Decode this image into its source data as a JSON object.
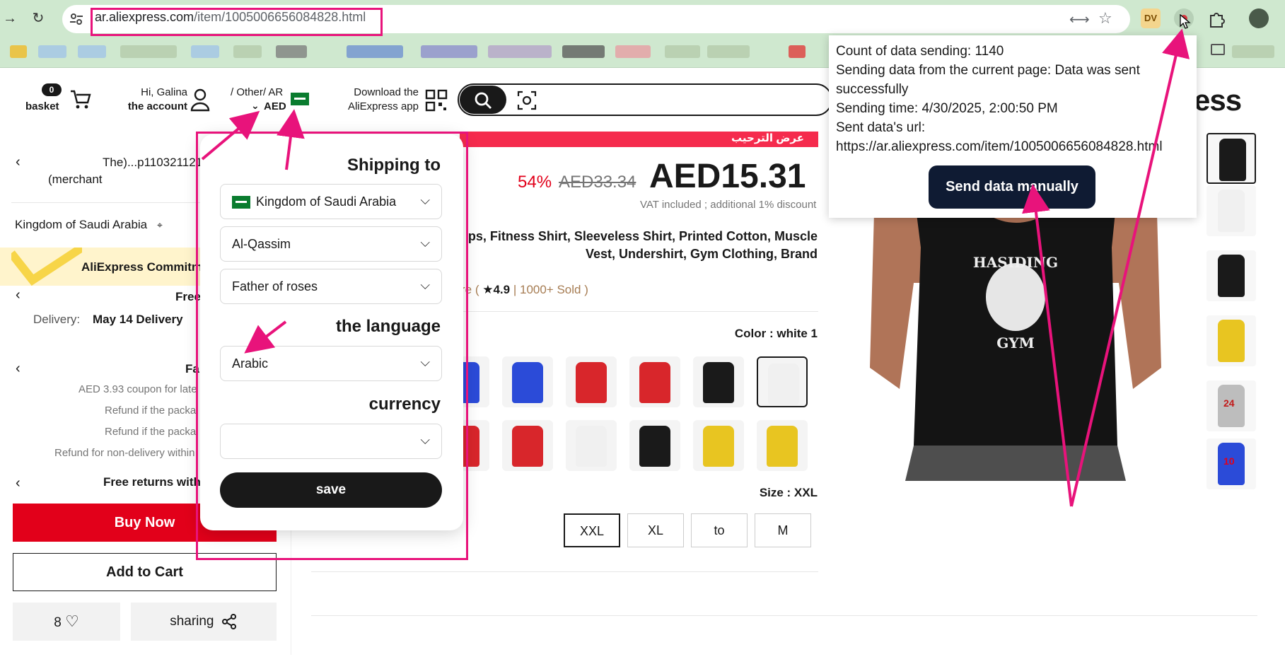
{
  "browser": {
    "url_host": "ar.aliexpress.com",
    "url_path": "/item/1005006656084828.html",
    "ext_dv_label": "DV"
  },
  "header": {
    "basket_count": "0",
    "basket_label": "basket",
    "greeting": "Hi, Galina",
    "account_label": "the account",
    "region_line": "/ Other/ AR",
    "currency_code": "AED",
    "app_line1": "Download the",
    "app_line2": "AliExpress app",
    "logo_partial": "press"
  },
  "left": {
    "store_line1": "The)...p1103211211",
    "store_line2": "(merchant",
    "location": "Kingdom of Saudi Arabia",
    "commitment": "AliExpress Commitm",
    "free_partial": "Free",
    "delivery_label": "Delivery:",
    "delivery_date": "May 14  Delivery",
    "fa_partial": "Fa",
    "coupon_line": "AED 3.93 coupon for late",
    "refund1": "Refund if the packa",
    "refund2": "Refund if the packa",
    "refund3": "Refund for non-delivery within",
    "returns": "Free returns with",
    "buy_now": "Buy Now",
    "add_to_cart": "Add to Cart",
    "wishlist_count": "8",
    "sharing": "sharing"
  },
  "product": {
    "promo_text": "عرض الترحيب",
    "discount": "54%",
    "old_price": "AED33.34",
    "price": "AED15.31",
    "vat_note": "VAT included ; additional 1% discount",
    "title_line1": "ps, Fitness Shirt, Sleeveless Shirt, Printed Cotton, Muscle",
    "title_line2": "Vest, Undershirt, Gym Clothing, Brand",
    "rating_prefix": "re (",
    "rating_star": "★4.9",
    "rating_sold": "| 1000+ Sold )",
    "color_label": "Color : white 1",
    "size_label": "Size : XXL",
    "sizes": [
      "XXL",
      "XL",
      "to",
      "M"
    ],
    "image_brand_top": "HASIDING",
    "image_brand_bottom": "GYM",
    "thumb_number_1": "24",
    "thumb_number_2": "10",
    "colors": {
      "row1": [
        "#2b4bd8",
        "#2b4bd8",
        "#d8262b",
        "#d8262b",
        "#1a1a1a",
        "#f0f0f0"
      ],
      "row2": [
        "#d8262b",
        "#d8262b",
        "#f0f0f0",
        "#1a1a1a",
        "#e8c521",
        "#e8c521"
      ],
      "thumbs": [
        "#1a1a1a",
        "#f0f0f0",
        "#1a1a1a",
        "#e8c521",
        "#bdbdbd",
        "#2b4bd8"
      ]
    }
  },
  "settings_popup": {
    "shipping_heading": "Shipping to",
    "country": "Kingdom of Saudi Arabia",
    "region": "Al-Qassim",
    "city": "Father of roses",
    "language_heading": "the language",
    "language": "Arabic",
    "currency_heading": "currency",
    "currency_value": "",
    "save": "save"
  },
  "extension_popup": {
    "count_line": "Count of data sending: 1140",
    "status_line1": "Sending data from the current page: Data was sent",
    "status_line2": "successfully",
    "time_line": "Sending time: 4/30/2025, 2:00:50 PM",
    "url_label": "Sent data's url:",
    "url_value": "https://ar.aliexpress.com/item/1005006656084828.html",
    "send_button": "Send data manually"
  },
  "annotation_color": "#e8137b"
}
